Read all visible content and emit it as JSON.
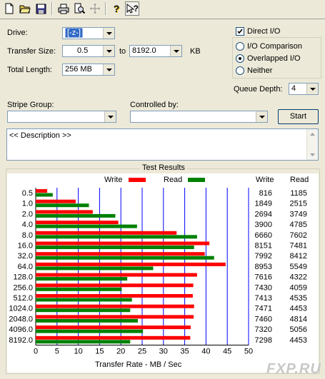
{
  "toolbar": {
    "buttons": [
      {
        "icon": "new-document-icon"
      },
      {
        "icon": "open-folder-icon"
      },
      {
        "icon": "save-disk-icon"
      },
      {
        "icon": "print-icon"
      },
      {
        "icon": "print-preview-icon"
      },
      {
        "icon": "move-icon"
      },
      {
        "icon": "help-icon",
        "label": "?"
      },
      {
        "icon": "context-help-icon",
        "label": "?"
      }
    ]
  },
  "settings": {
    "drive_label": "Drive:",
    "drive_value": "[-z-]",
    "transfer_size_label": "Transfer Size:",
    "transfer_from": "0.5",
    "to_label": "to",
    "transfer_to": "8192.0",
    "kb_label": "KB",
    "total_length_label": "Total Length:",
    "total_length_value": "256 MB",
    "direct_io_label": "Direct I/O",
    "io_comparison_label": "I/O Comparison",
    "overlapped_io_label": "Overlapped I/O",
    "neither_label": "Neither",
    "queue_depth_label": "Queue Depth:",
    "queue_depth_value": "4",
    "stripe_group_label": "Stripe Group:",
    "controlled_by_label": "Controlled by:",
    "start_label": "Start",
    "description_text": "<< Description >>"
  },
  "colors": {
    "write": "#ff0000",
    "read": "#008000",
    "grid": "#0000ff"
  },
  "chart_data": {
    "type": "bar",
    "title": "Test Results",
    "xlabel": "Transfer Rate - MB / Sec",
    "ylabel": "",
    "xlim": [
      0,
      50
    ],
    "xticks": [
      0,
      5,
      10,
      15,
      20,
      25,
      30,
      35,
      40,
      45,
      50
    ],
    "categories": [
      "0.5",
      "1.0",
      "2.0",
      "4.0",
      "8.0",
      "16.0",
      "32.0",
      "64.0",
      "128.0",
      "256.0",
      "512.0",
      "1024.0",
      "2048.0",
      "4096.0",
      "8192.0"
    ],
    "series": [
      {
        "name": "Write",
        "values": [
          2.7,
          9.4,
          13.4,
          19.4,
          33.1,
          40.8,
          39.7,
          44.6,
          37.9,
          37.0,
          36.9,
          37.2,
          37.1,
          36.4,
          36.3
        ]
      },
      {
        "name": "Read",
        "values": [
          4.0,
          12.5,
          18.7,
          23.8,
          37.9,
          37.2,
          41.9,
          27.6,
          21.5,
          20.2,
          22.6,
          22.2,
          24.0,
          25.2,
          22.2
        ]
      }
    ],
    "table_headers": [
      "Write",
      "Read"
    ],
    "write_kb": [
      "816",
      "1849",
      "2694",
      "3900",
      "6660",
      "8151",
      "7992",
      "8953",
      "7616",
      "7430",
      "7413",
      "7471",
      "7460",
      "7320",
      "7298"
    ],
    "read_kb": [
      "1185",
      "2515",
      "3749",
      "4785",
      "7602",
      "7481",
      "8412",
      "5549",
      "4322",
      "4059",
      "4535",
      "4453",
      "4814",
      "5056",
      "4453"
    ]
  },
  "watermark": "FXP.RU"
}
